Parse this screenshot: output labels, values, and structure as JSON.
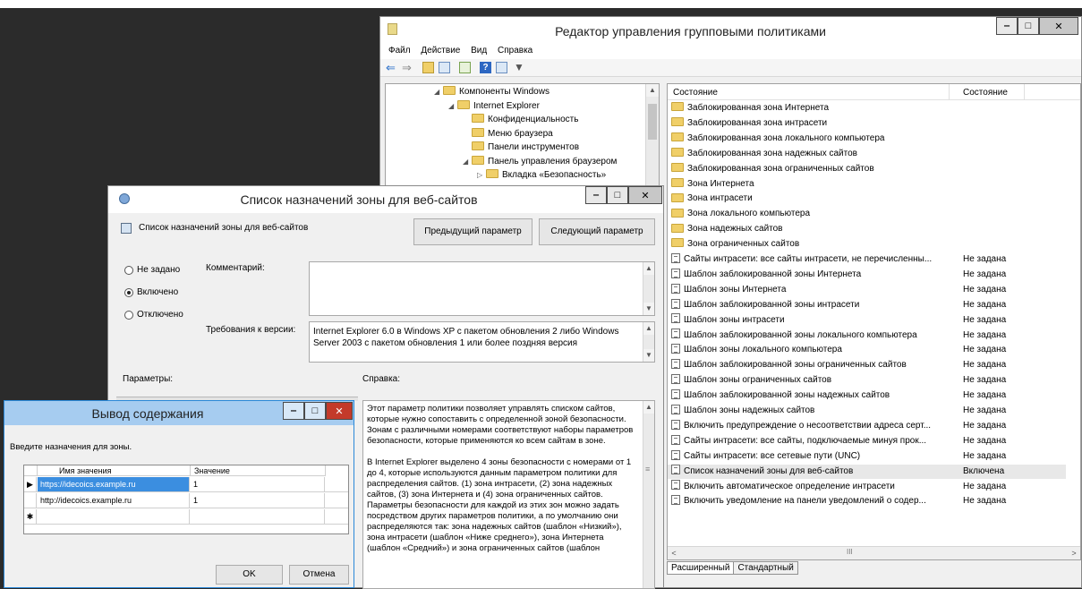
{
  "gpo_window": {
    "title": "Редактор управления групповыми политиками",
    "menu": [
      "Файл",
      "Действие",
      "Вид",
      "Справка"
    ],
    "tree": [
      {
        "label": "Компоненты Windows",
        "level": 0,
        "expander": "◢"
      },
      {
        "label": "Internet Explorer",
        "level": 1,
        "expander": "◢"
      },
      {
        "label": "Конфиденциальность",
        "level": 2,
        "expander": ""
      },
      {
        "label": "Меню браузера",
        "level": 2,
        "expander": ""
      },
      {
        "label": "Панели инструментов",
        "level": 2,
        "expander": ""
      },
      {
        "label": "Панель управления браузером",
        "level": 2,
        "expander": "◢"
      },
      {
        "label": "Вкладка «Безопасность»",
        "level": 3,
        "expander": "▷"
      }
    ],
    "list_header": {
      "col_name": "Состояние",
      "col_state": "Состояние"
    },
    "folders": [
      "Заблокированная зона Интернета",
      "Заблокированная зона интрасети",
      "Заблокированная зона локального компьютера",
      "Заблокированная зона надежных сайтов",
      "Заблокированная зона ограниченных сайтов",
      "Зона Интернета",
      "Зона интрасети",
      "Зона локального компьютера",
      "Зона надежных сайтов",
      "Зона ограниченных сайтов"
    ],
    "policies": [
      {
        "name": "Сайты интрасети: все сайты интрасети, не перечисленны...",
        "state": "Не задана"
      },
      {
        "name": "Шаблон заблокированной зоны Интернета",
        "state": "Не задана"
      },
      {
        "name": "Шаблон зоны Интернета",
        "state": "Не задана"
      },
      {
        "name": "Шаблон заблокированной зоны интрасети",
        "state": "Не задана"
      },
      {
        "name": "Шаблон зоны интрасети",
        "state": "Не задана"
      },
      {
        "name": "Шаблон заблокированной зоны локального компьютера",
        "state": "Не задана"
      },
      {
        "name": "Шаблон зоны локального компьютера",
        "state": "Не задана"
      },
      {
        "name": "Шаблон заблокированной зоны ограниченных сайтов",
        "state": "Не задана"
      },
      {
        "name": "Шаблон зоны ограниченных сайтов",
        "state": "Не задана"
      },
      {
        "name": "Шаблон заблокированной зоны надежных сайтов",
        "state": "Не задана"
      },
      {
        "name": "Шаблон зоны надежных сайтов",
        "state": "Не задана"
      },
      {
        "name": "Включить предупреждение о несоответствии адреса серт...",
        "state": "Не задана"
      },
      {
        "name": "Сайты интрасети: все сайты, подключаемые минуя прок...",
        "state": "Не задана"
      },
      {
        "name": "Сайты интрасети: все сетевые пути (UNC)",
        "state": "Не задана"
      },
      {
        "name": "Список назначений зоны для веб-сайтов",
        "state": "Включена",
        "selected": true
      },
      {
        "name": "Включить автоматическое определение интрасети",
        "state": "Не задана"
      },
      {
        "name": "Включить уведомление на панели уведомлений о содер...",
        "state": "Не задана"
      }
    ],
    "scroll_thumb": "III",
    "tabs": [
      "Расширенный",
      "Стандартный"
    ]
  },
  "policy_dialog": {
    "title": "Список назначений зоны для веб-сайтов",
    "heading": "Список назначений зоны для веб-сайтов",
    "prev_button": "Предыдущий параметр",
    "next_button": "Следующий параметр",
    "radio_not_set": "Не задано",
    "radio_enabled": "Включено",
    "radio_disabled": "Отключено",
    "comment_label": "Комментарий:",
    "supported_label": "Требования к версии:",
    "supported_text": "Internet Explorer 6.0 в Windows XP с пакетом обновления 2 либо Windows Server 2003 с пакетом обновления 1 или более поздняя версия",
    "params_label": "Параметры:",
    "help_label": "Справка:",
    "help_text_1": "Этот параметр политики позволяет управлять списком сайтов, которые нужно сопоставить с определенной зоной безопасности. Зонам с различными номерами соответствуют наборы параметров безопасности, которые применяются ко всем сайтам в зоне.",
    "help_text_2": "В Internet Explorer выделено 4 зоны безопасности с номерами от 1 до 4, которые используются данным параметром политики для распределения сайтов. (1) зона интрасети, (2) зона надежных сайтов, (3) зона Интернета и (4) зона ограниченных сайтов. Параметры безопасности для каждой из этих зон можно задать посредством других параметров политики, а по умолчанию они распределяются так: зона надежных сайтов (шаблон «Низкий»), зона интрасети (шаблон «Ниже среднего»), зона Интернета (шаблон «Средний») и зона ограниченных сайтов (шаблон"
  },
  "show_dialog": {
    "title": "Вывод содержания",
    "prompt": "Введите назначения для зоны.",
    "col_name": "Имя значения",
    "col_value": "Значение",
    "rows": [
      {
        "marker": "▶",
        "name": "https://idecoics.example.ru",
        "value": "1"
      },
      {
        "marker": "",
        "name": "http://idecoics.example.ru",
        "value": "1"
      },
      {
        "marker": "✱",
        "name": "",
        "value": ""
      }
    ],
    "ok_button": "OK",
    "cancel_button": "Отмена"
  },
  "window_buttons": {
    "minimize": "‒",
    "maximize": "□",
    "close": "✕"
  }
}
